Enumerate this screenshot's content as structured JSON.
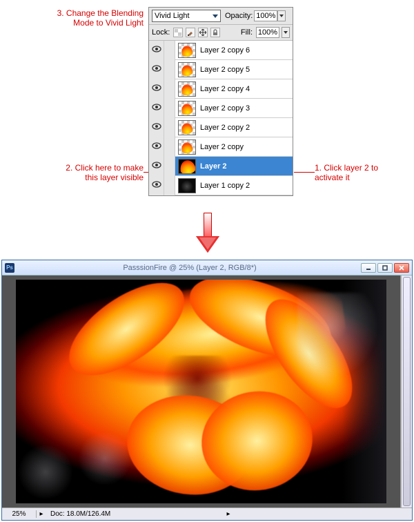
{
  "annotations": {
    "step1": "1. Click layer 2 to\nactivate it",
    "step2": "2. Click here to make\nthis layer visible",
    "step3": "3. Change the Blending\nMode to Vivid Light"
  },
  "panel": {
    "blend_mode": "Vivid Light",
    "opacity_label": "Opacity:",
    "opacity_value": "100%",
    "lock_label": "Lock:",
    "fill_label": "Fill:",
    "fill_value": "100%",
    "layers": [
      {
        "name": "Layer 2 copy 6",
        "transparent": true,
        "selected": false
      },
      {
        "name": "Layer 2 copy 5",
        "transparent": true,
        "selected": false
      },
      {
        "name": "Layer 2 copy 4",
        "transparent": true,
        "selected": false
      },
      {
        "name": "Layer 2 copy 3",
        "transparent": true,
        "selected": false
      },
      {
        "name": "Layer 2 copy 2",
        "transparent": true,
        "selected": false
      },
      {
        "name": "Layer 2 copy",
        "transparent": true,
        "selected": false
      },
      {
        "name": "Layer 2",
        "transparent": false,
        "selected": true,
        "big": true
      },
      {
        "name": "Layer 1 copy 2",
        "transparent": false,
        "selected": false,
        "dark": true
      }
    ]
  },
  "window": {
    "title": "PasssionFire @ 25% (Layer 2, RGB/8*)",
    "zoom": "25%",
    "doc_info": "Doc: 18.0M/126.4M"
  }
}
